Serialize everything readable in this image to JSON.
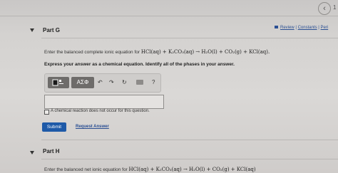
{
  "top_bar": {
    "back_icon": "chevron-left-icon",
    "page_label": "1"
  },
  "part_g": {
    "title": "Part G",
    "links": {
      "review": "Review",
      "sep1": "|",
      "constants": "Constants",
      "sep2": "|",
      "periodic": "Peri"
    },
    "prompt": "Enter the balanced complete ionic equation for",
    "equation": "HCl(aq) + K₂CO₃(aq) → H₂O(l) + CO₂(g) + KCl(aq).",
    "instruction": "Express your answer as a chemical equation. Identify all of the phases in your answer.",
    "toolbar": {
      "templates_icon": "template-icon",
      "symbols_label": "AΣΦ",
      "undo_icon": "undo-icon",
      "redo_icon": "redo-icon",
      "reset_icon": "reset-icon",
      "keyboard_icon": "keyboard-icon",
      "help_label": "?"
    },
    "answer_value": "",
    "no_reaction_label": "A chemical reaction does not occur for this question.",
    "submit_label": "Submit",
    "request_answer_label": "Request Answer"
  },
  "part_h": {
    "title": "Part H",
    "prompt": "Enter the balanced net ionic equation for",
    "equation": "HCl(aq) + K₂CO₃(aq) → H₂O(l) + CO₂(g) + KCl(aq)"
  },
  "colors": {
    "accent": "#1e5aa8",
    "link": "#2a4f93",
    "background": "#d6d4d2"
  }
}
